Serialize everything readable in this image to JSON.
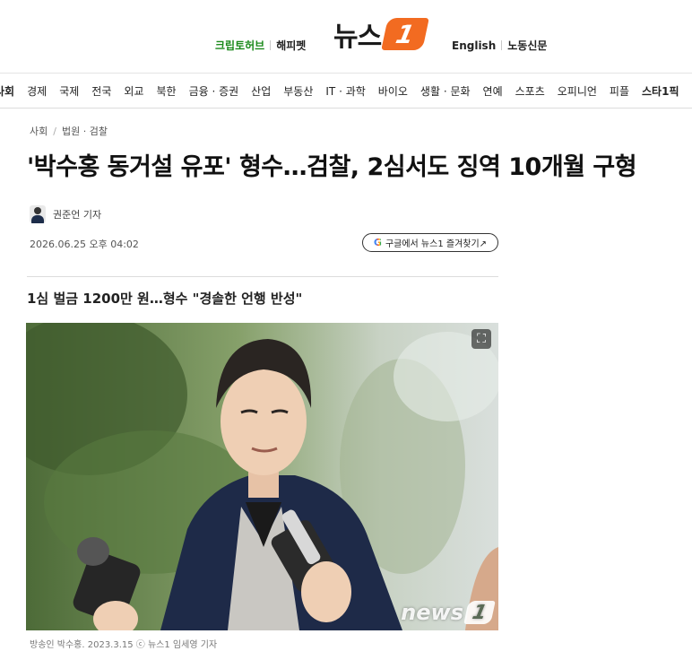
{
  "header": {
    "left_link": "크립토허브",
    "left_link2": "해피펫",
    "logo_text": "뉴스",
    "logo_badge": "1",
    "right_link": "English",
    "right_link2": "노동신문",
    "accent_color": "#f26b21"
  },
  "nav": {
    "items": [
      "사회",
      "경제",
      "국제",
      "전국",
      "외교",
      "북한",
      "금융 · 증권",
      "산업",
      "부동산",
      "IT · 과학",
      "바이오",
      "생활 · 문화",
      "연예",
      "스포츠",
      "오피니언",
      "피플",
      "스타1픽"
    ]
  },
  "article": {
    "breadcrumb": [
      "사회",
      "법원 · 검찰"
    ],
    "title": "'박수홍 동거설 유포' 형수…검찰, 2심서도 징역 10개월 구형",
    "author": "권준언 기자",
    "date": "2026.06.25 오후 04:02",
    "google_button": "구글에서 뉴스1 즐겨찾기↗",
    "google_icon": "G",
    "subtitle": "1심 벌금 1200만 원…형수 \"경솔한 언행 반성\"",
    "photo_caption": "방송인 박수홍. 2023.3.15 ⓒ 뉴스1 임세영 기자",
    "watermark_text": "news",
    "watermark_badge": "1",
    "expand_icon": "⛶"
  }
}
